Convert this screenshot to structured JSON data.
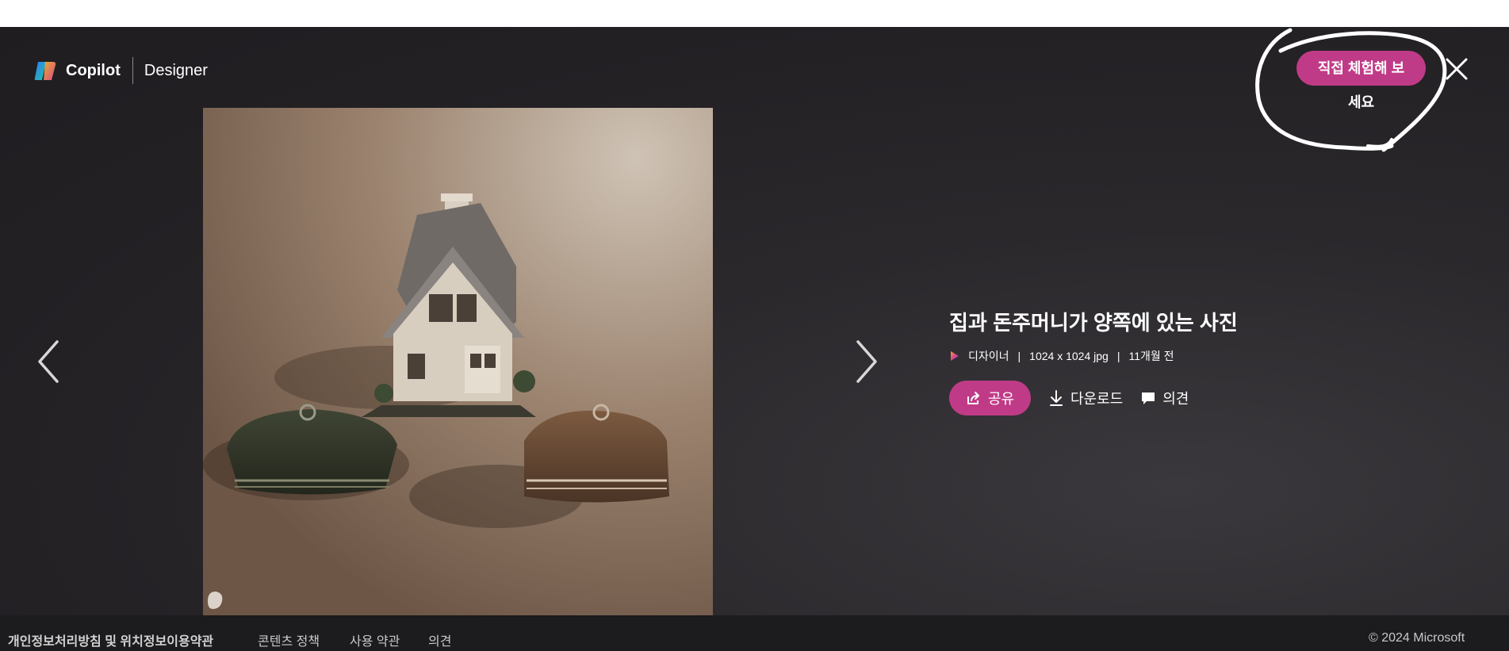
{
  "header": {
    "brand": "Copilot",
    "product": "Designer",
    "try_button_line1": "직접 체험해 보",
    "try_button_line2": "세요"
  },
  "image": {
    "title": "집과 돈주머니가 양쪽에 있는 사진",
    "source": "디자이너",
    "dimensions": "1024 x 1024 jpg",
    "age": "11개월 전",
    "meta_separator": "|"
  },
  "actions": {
    "share": "공유",
    "download": "다운로드",
    "feedback": "의견"
  },
  "footer": {
    "links": [
      "개인정보처리방침 및 위치정보이용약관",
      "콘텐츠 정책",
      "사용 약관",
      "의견"
    ],
    "copyright": "© 2024 Microsoft"
  },
  "colors": {
    "accent": "#c03b87",
    "background": "#262427",
    "footer": "#1c1b1d"
  },
  "icons": [
    "copilot-logo",
    "close-icon",
    "chevron-left-icon",
    "chevron-right-icon",
    "share-icon",
    "download-icon",
    "comment-icon",
    "designer-badge-icon"
  ]
}
